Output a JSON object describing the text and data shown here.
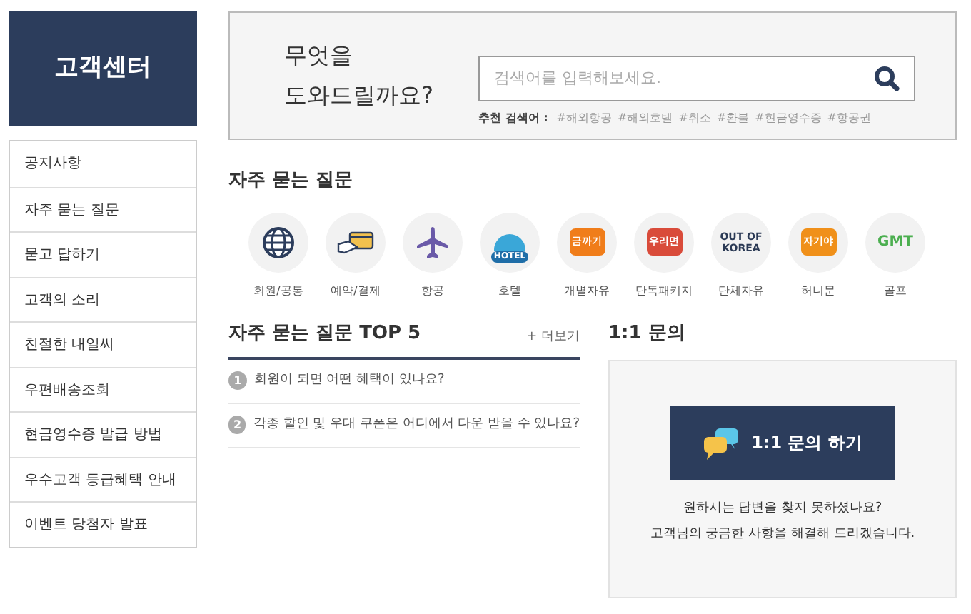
{
  "sidebar": {
    "title": "고객센터",
    "items": [
      {
        "label": "공지사항",
        "selected": false
      },
      {
        "label": "자주 묻는 질문",
        "selected": false
      },
      {
        "label": "묻고 답하기",
        "selected": false
      },
      {
        "label": "고객의 소리",
        "selected": false
      },
      {
        "label": "친절한 내일씨",
        "selected": false
      },
      {
        "label": "우편배송조회",
        "selected": false
      },
      {
        "label": "현금영수증 발급 방법",
        "selected": false
      },
      {
        "label": "우수고객 등급혜택 안내",
        "selected": false
      },
      {
        "label": "이벤트 당첨자 발표",
        "selected": false
      }
    ]
  },
  "search": {
    "heading_lines": [
      "무엇을",
      "도와드릴까요?"
    ],
    "placeholder": "검색어를 입력해보세요.",
    "suggest_label": "추천 검색어 :",
    "tags": [
      "#해외항공",
      "#해외호텔",
      "#취소",
      "#환불",
      "#현금영수증",
      "#항공권"
    ]
  },
  "faq_categories": {
    "title": "자주 묻는 질문",
    "items": [
      {
        "label": "회원/공통",
        "kind": "globe"
      },
      {
        "label": "예약/결제",
        "kind": "card"
      },
      {
        "label": "항공",
        "kind": "plane"
      },
      {
        "label": "호텔",
        "kind": "hotel",
        "logo_text": "HOTEL"
      },
      {
        "label": "개별자유",
        "kind": "logo",
        "logo_text": "금까기",
        "color": "#f07d1a"
      },
      {
        "label": "단독패키지",
        "kind": "logo",
        "logo_text": "우리면",
        "color": "#d94b3a"
      },
      {
        "label": "단체자유",
        "kind": "textlogo",
        "logo_text": "OUT OF KOREA",
        "color": "#2b3a55"
      },
      {
        "label": "허니문",
        "kind": "logo",
        "logo_text": "자기야",
        "color": "#f0901a"
      },
      {
        "label": "골프",
        "kind": "textlogo",
        "logo_text": "GMT",
        "color": "#4caf50"
      }
    ]
  },
  "faq_top": {
    "title": "자주 묻는 질문 TOP 5",
    "more": "+ 더보기",
    "items": [
      {
        "number": "1",
        "question": "회원이 되면 어떤 혜택이 있나요?"
      },
      {
        "number": "2",
        "question": "각종 할인 및 우대 쿠폰은 어디에서 다운 받을 수 있나요?"
      }
    ]
  },
  "inquiry": {
    "title": "1:1 문의",
    "button": "1:1 문의 하기",
    "message_lines": [
      "원하시는 답변을 찾지 못하셨나요?",
      "고객님의 궁금한 사항을 해결해 드리겠습니다."
    ]
  }
}
